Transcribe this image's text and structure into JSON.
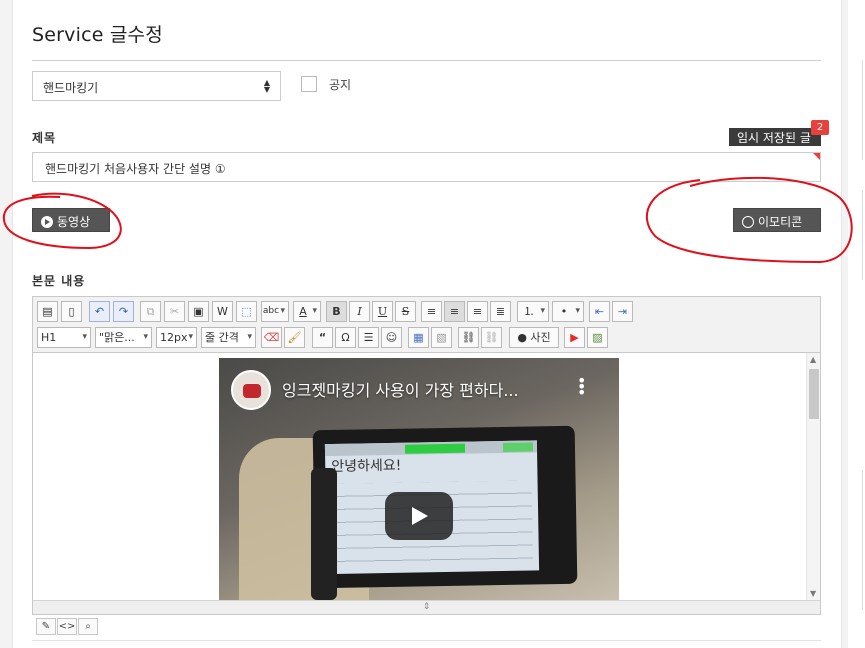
{
  "page": {
    "title": "Service 글수정"
  },
  "category": {
    "selected": "핸드마킹기"
  },
  "notice": {
    "label": "공지",
    "checked": false
  },
  "subject": {
    "label": "제목",
    "value": "핸드마킹기 처음사용자 간단 설명 ①",
    "draft_button": "임시 저장된 글",
    "draft_count": "2"
  },
  "actions": {
    "video_button": "동영상",
    "emoticon_button": "이모티콘"
  },
  "body": {
    "label": "본문 내용"
  },
  "toolbar": {
    "heading_select": "H1",
    "font_select": "\"맑은...",
    "size_select": "12px",
    "line_height_select": "줄 간격",
    "photo_button": "사진",
    "bold": "B",
    "italic": "I",
    "underline": "U",
    "strike": "S",
    "quote": "“",
    "omega": "Ω"
  },
  "video": {
    "title": "잉크젯마킹기 사용이 가장 편하다...",
    "screen_text": "안녕하세요!"
  },
  "colors": {
    "accent_red": "#e8413b",
    "dark_button": "#555555",
    "annotation": "#e0101a"
  }
}
